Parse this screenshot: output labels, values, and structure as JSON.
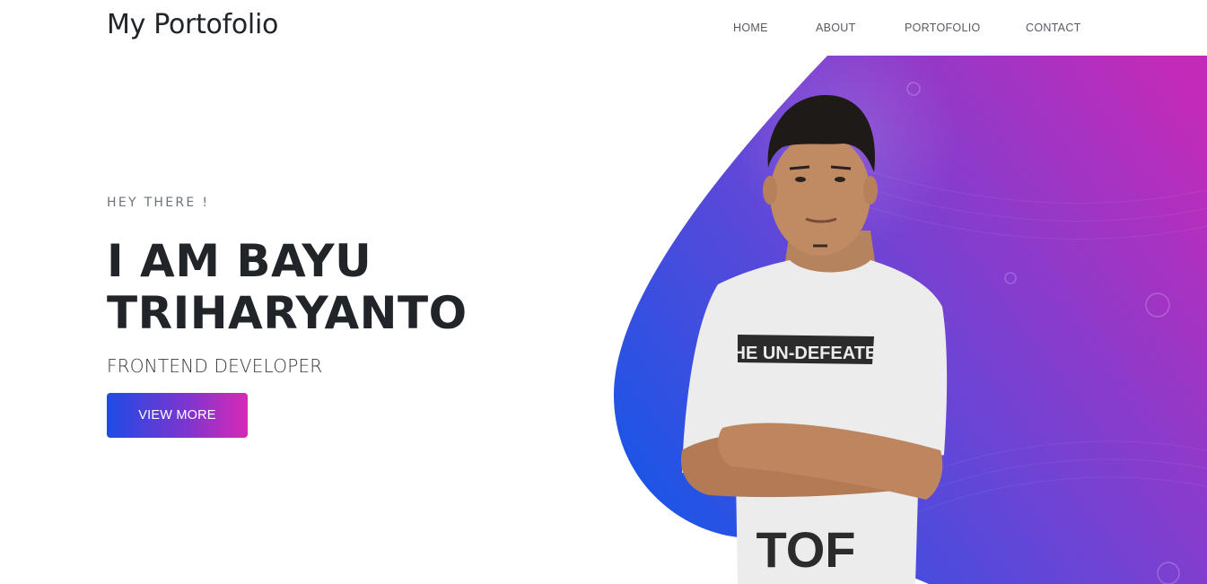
{
  "header": {
    "brand": "My Portofolio",
    "nav": [
      {
        "label": "HOME"
      },
      {
        "label": "ABOUT"
      },
      {
        "label": "PORTOFOLIO"
      },
      {
        "label": "CONTACT"
      }
    ]
  },
  "hero": {
    "greeting": "HEY THERE !",
    "name_line1": "I AM BAYU",
    "name_line2": "TRIHARYANTO",
    "role": "FRONTEND DEVELOPER",
    "cta_label": "VIEW MORE",
    "shirt_text": "THE UN-DEFEATED",
    "shirt_lower_text": "TOF"
  },
  "colors": {
    "gradient_start": "#1f4be6",
    "gradient_mid": "#7a36cf",
    "gradient_end": "#d829b6",
    "text_dark": "#212529",
    "nav_text": "#555b61"
  }
}
